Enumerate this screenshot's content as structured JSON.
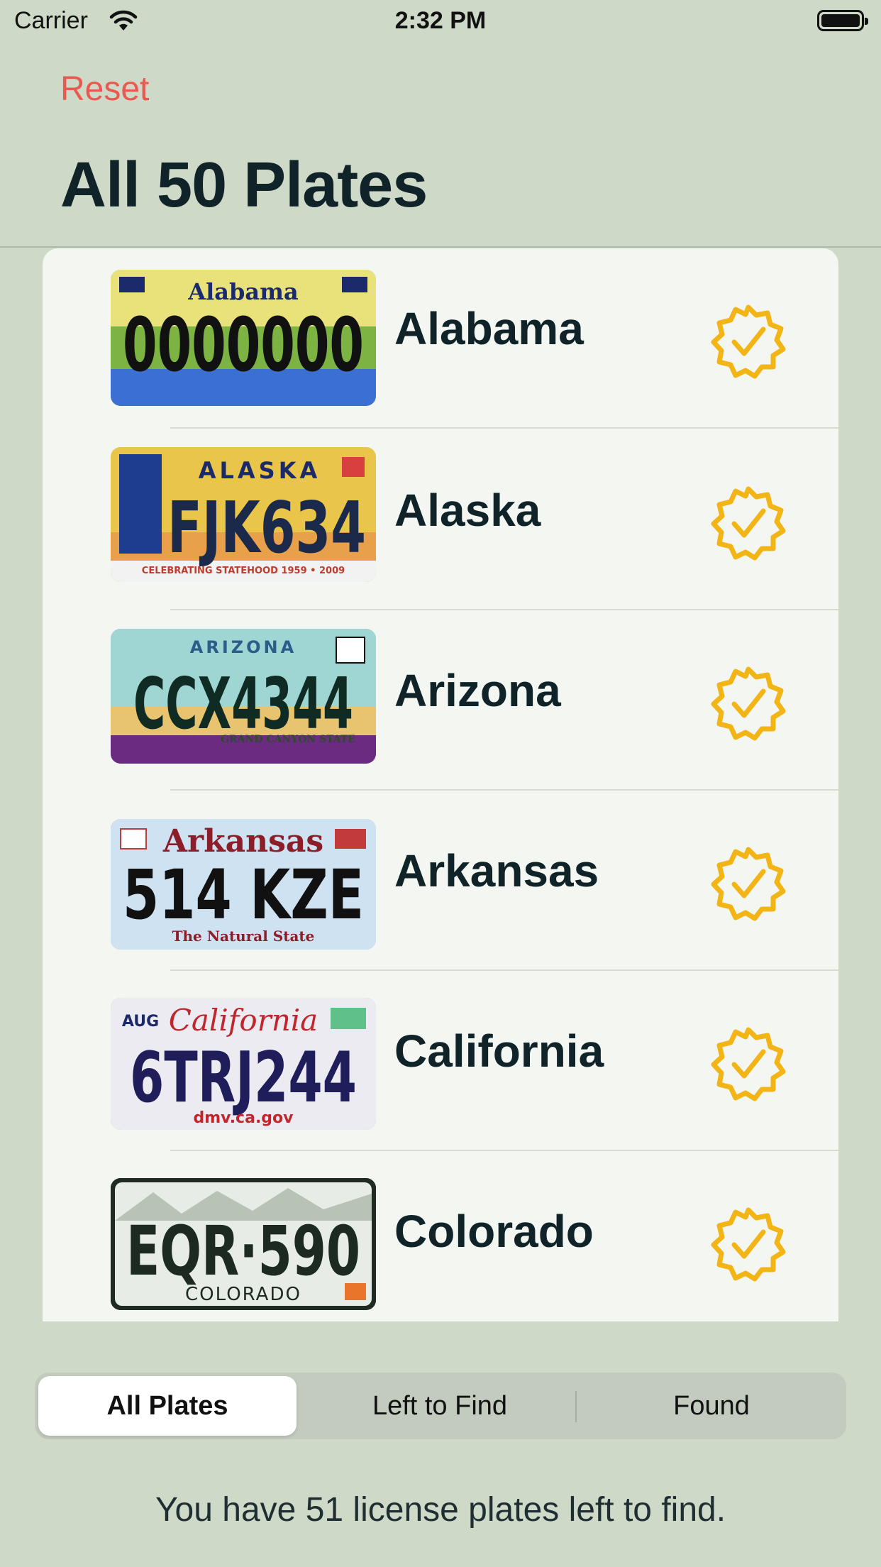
{
  "status_bar": {
    "carrier": "Carrier",
    "time": "2:32 PM"
  },
  "nav": {
    "reset_label": "Reset",
    "title": "All 50 Plates"
  },
  "plates": [
    {
      "state": "Alabama",
      "plate_number": "0000000",
      "plate_header": "Alabama",
      "plate_footer": "",
      "found": true
    },
    {
      "state": "Alaska",
      "plate_number": "FJK634",
      "plate_header": "ALASKA",
      "plate_footer": "CELEBRATING STATEHOOD 1959 • 2009",
      "found": true
    },
    {
      "state": "Arizona",
      "plate_number": "CCX4344",
      "plate_header": "ARIZONA",
      "plate_footer": "GRAND CANYON STATE",
      "found": true
    },
    {
      "state": "Arkansas",
      "plate_number": "514 KZE",
      "plate_header": "Arkansas",
      "plate_footer": "The Natural State",
      "found": true
    },
    {
      "state": "California",
      "plate_number": "6TRJ244",
      "plate_header": "California",
      "plate_footer": "dmv.ca.gov",
      "found": true
    },
    {
      "state": "Colorado",
      "plate_number": "EQR·590",
      "plate_header": "",
      "plate_footer": "COLORADO",
      "found": true
    }
  ],
  "segments": [
    {
      "label": "All Plates",
      "selected": true
    },
    {
      "label": "Left to Find",
      "selected": false
    },
    {
      "label": "Found",
      "selected": false
    }
  ],
  "footer": {
    "message": "You have 51 license plates left to find."
  },
  "colors": {
    "accent": "#e85a4f",
    "badge": "#f2b515",
    "background": "#cfd9c7",
    "list_bg": "#f3f6f1"
  }
}
